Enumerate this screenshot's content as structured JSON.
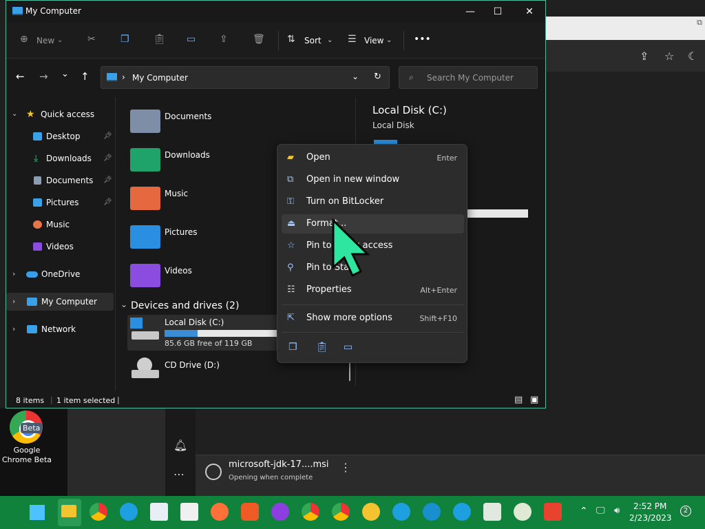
{
  "explorer": {
    "title": "My Computer",
    "toolbar": {
      "new_label": "New",
      "sort_label": "Sort",
      "view_label": "View"
    },
    "address": "My Computer",
    "search_placeholder": "Search My Computer",
    "sidebar": {
      "quick_access": "Quick access",
      "items": [
        {
          "label": "Desktop"
        },
        {
          "label": "Downloads"
        },
        {
          "label": "Documents"
        },
        {
          "label": "Pictures"
        },
        {
          "label": "Music"
        },
        {
          "label": "Videos"
        }
      ],
      "onedrive": "OneDrive",
      "my_computer": "My Computer",
      "network": "Network"
    },
    "folders": [
      {
        "label": "Documents"
      },
      {
        "label": "Downloads"
      },
      {
        "label": "Music"
      },
      {
        "label": "Pictures"
      },
      {
        "label": "Videos"
      }
    ],
    "devices_header": "Devices and drives (2)",
    "drives": [
      {
        "label": "Local Disk (C:)",
        "free": "85.6 GB free of 119 GB",
        "used_fraction": 0.28
      },
      {
        "label": "CD Drive (D:)"
      }
    ],
    "details": {
      "title": "Local Disk (C:)",
      "subtitle": "Local Disk"
    },
    "status": {
      "items": "8 items",
      "selected": "1 item selected"
    }
  },
  "context_menu": {
    "items": [
      {
        "label": "Open",
        "shortcut": "Enter"
      },
      {
        "label": "Open in new window",
        "shortcut": ""
      },
      {
        "label": "Turn on BitLocker",
        "shortcut": ""
      },
      {
        "label": "Format...",
        "shortcut": ""
      },
      {
        "label": "Pin to Quick access",
        "shortcut": ""
      },
      {
        "label": "Pin to Start",
        "shortcut": ""
      },
      {
        "label": "Properties",
        "shortcut": "Alt+Enter"
      }
    ],
    "more": {
      "label": "Show more options",
      "shortcut": "Shift+F10"
    }
  },
  "download": {
    "filename": "microsoft-jdk-17....msi",
    "status": "Opening when complete"
  },
  "desktop": {
    "chrome_label": "Google Chrome Beta",
    "beta_badge": "Beta"
  },
  "taskbar": {
    "time": "2:52 PM",
    "date": "2/23/2023",
    "notifications": "2"
  },
  "colors": {
    "accent": "#4bc0a0",
    "taskbar": "#11823b",
    "drive_bar": "#3b8ed6",
    "cursor": "#2ee6a0"
  }
}
